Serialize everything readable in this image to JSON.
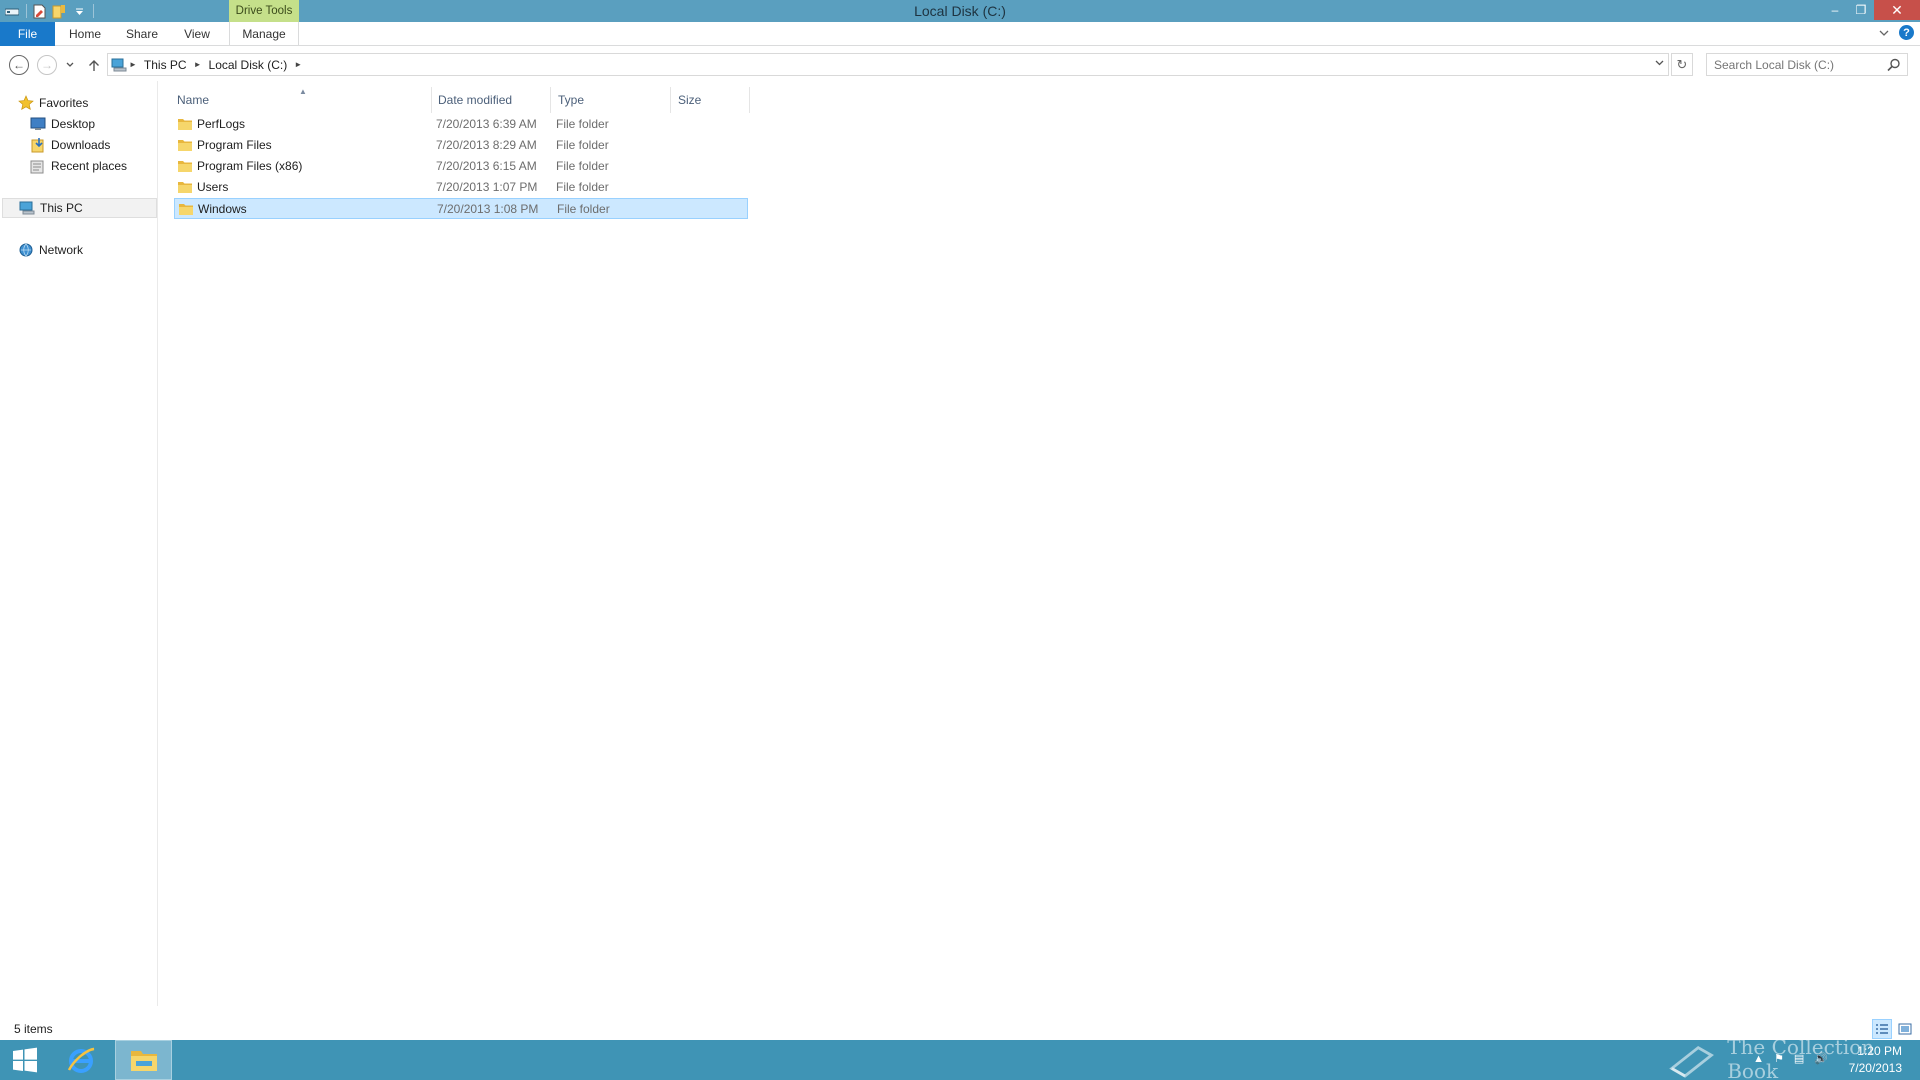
{
  "window": {
    "title": "Local Disk (C:)",
    "context_tab": "Drive Tools",
    "controls": {
      "minimize": "–",
      "restore": "❐",
      "close": "✕"
    }
  },
  "ribbon": {
    "tabs": [
      "File",
      "Home",
      "Share",
      "View",
      "Manage"
    ],
    "help": "?"
  },
  "address": {
    "crumbs": [
      "This PC",
      "Local Disk (C:)"
    ],
    "search_placeholder": "Search Local Disk (C:)"
  },
  "nav": {
    "favorites": "Favorites",
    "desktop": "Desktop",
    "downloads": "Downloads",
    "recent": "Recent places",
    "this_pc": "This PC",
    "network": "Network"
  },
  "columns": {
    "name": "Name",
    "date": "Date modified",
    "type": "Type",
    "size": "Size"
  },
  "files": [
    {
      "name": "PerfLogs",
      "date": "7/20/2013 6:39 AM",
      "type": "File folder",
      "size": ""
    },
    {
      "name": "Program Files",
      "date": "7/20/2013 8:29 AM",
      "type": "File folder",
      "size": ""
    },
    {
      "name": "Program Files (x86)",
      "date": "7/20/2013 6:15 AM",
      "type": "File folder",
      "size": ""
    },
    {
      "name": "Users",
      "date": "7/20/2013 1:07 PM",
      "type": "File folder",
      "size": ""
    },
    {
      "name": "Windows",
      "date": "7/20/2013 1:08 PM",
      "type": "File folder",
      "size": "",
      "selected": true
    }
  ],
  "status": {
    "count": "5 items"
  },
  "taskbar": {
    "watermark": "The Collection Book",
    "time": "1:20 PM",
    "date": "7/20/2013"
  },
  "colors": {
    "titlebar": "#5a9fbf",
    "file_tab": "#1979ca",
    "context_tab": "#c5e08a",
    "selection": "#cce8ff",
    "taskbar": "#3f94b5",
    "close": "#c7504a"
  }
}
